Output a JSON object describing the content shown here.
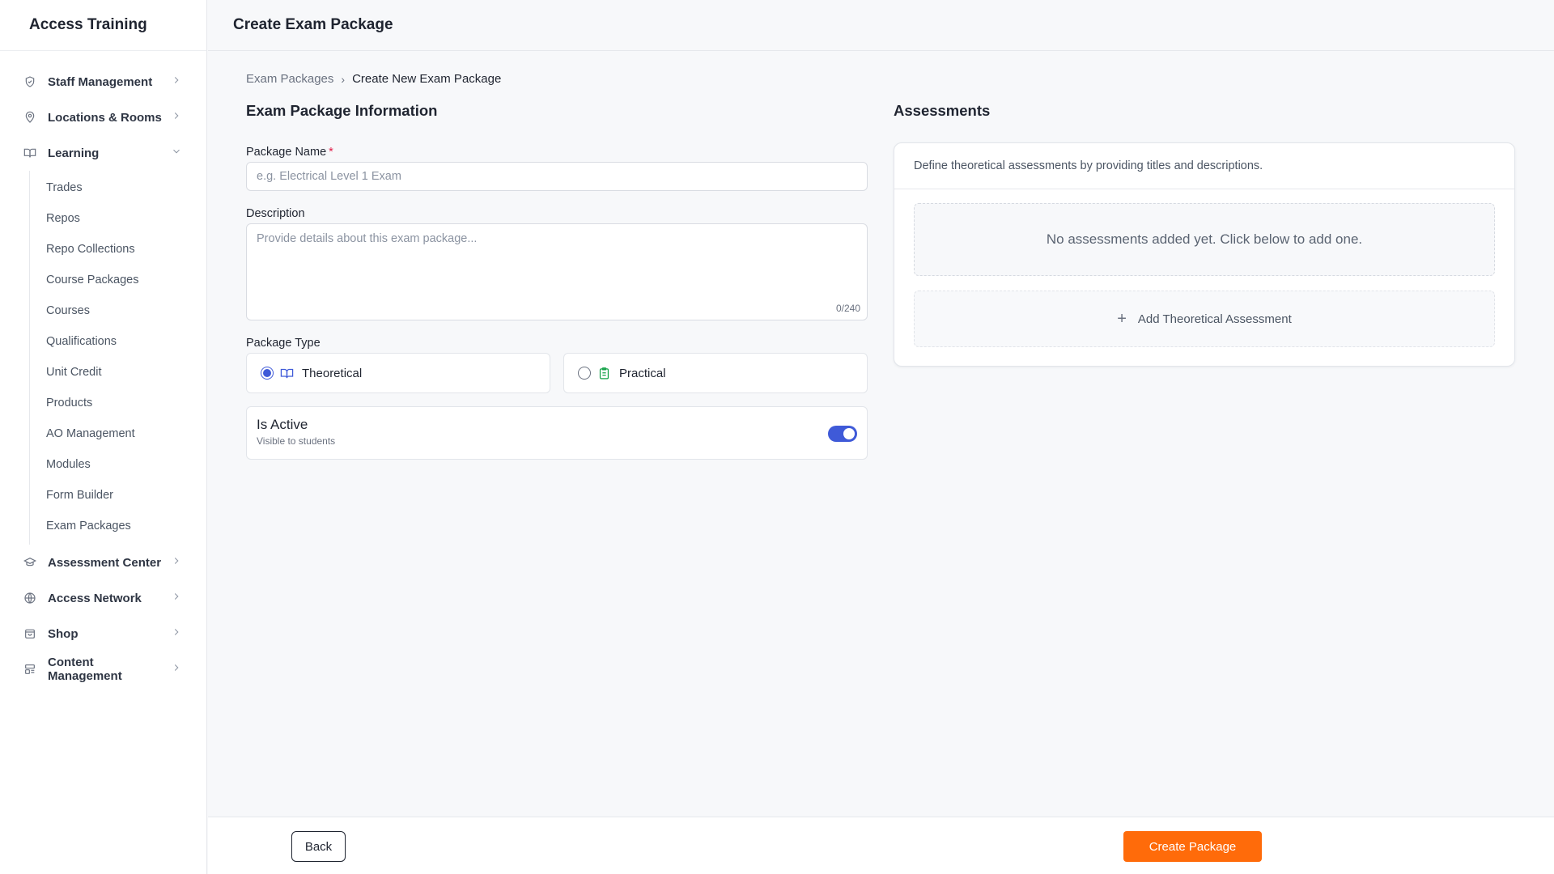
{
  "app": {
    "title": "Access Training"
  },
  "header": {
    "title": "Create Exam Package"
  },
  "sidebar": {
    "items": [
      {
        "label": "Staff Management",
        "icon": "shield-icon"
      },
      {
        "label": "Locations & Rooms",
        "icon": "map-pin-icon"
      },
      {
        "label": "Learning",
        "icon": "book-open-icon",
        "expanded": true
      }
    ],
    "learning_children": [
      "Trades",
      "Repos",
      "Repo Collections",
      "Course Packages",
      "Courses",
      "Qualifications",
      "Unit Credit",
      "Products",
      "AO Management",
      "Modules",
      "Form Builder",
      "Exam Packages"
    ],
    "items_after": [
      {
        "label": "Assessment Center",
        "icon": "graduation-cap-icon"
      },
      {
        "label": "Access Network",
        "icon": "globe-icon"
      },
      {
        "label": "Shop",
        "icon": "shopping-bag-icon"
      },
      {
        "label": "Content Management",
        "icon": "layout-icon"
      }
    ]
  },
  "breadcrumb": {
    "parent": "Exam Packages",
    "separator": "›",
    "current": "Create New Exam Package"
  },
  "form": {
    "section_title": "Exam Package Information",
    "name_label": "Package Name",
    "required_mark": "*",
    "name_value": "",
    "name_placeholder": "e.g. Electrical Level 1 Exam",
    "description_label": "Description",
    "description_value": "",
    "description_placeholder": "Provide details about this exam package...",
    "description_counter": "0/240",
    "type_label": "Package Type",
    "types": [
      {
        "label": "Theoretical",
        "selected": true,
        "icon": "book-open-icon",
        "color": "#3f5ad8"
      },
      {
        "label": "Practical",
        "selected": false,
        "icon": "clipboard-icon",
        "color": "#16a34a"
      }
    ],
    "active_title": "Is Active",
    "active_subtitle": "Visible to students",
    "active_on": true
  },
  "assessments": {
    "title": "Assessments",
    "description": "Define theoretical assessments by providing titles and descriptions.",
    "empty_text": "No assessments added yet. Click below to add one.",
    "add_label": "Add Theoretical Assessment",
    "add_icon": "plus-icon"
  },
  "footer": {
    "back_label": "Back",
    "create_label": "Create Package"
  },
  "colors": {
    "accent": "#3f5ad8",
    "primary_button": "#ff6b0a"
  }
}
